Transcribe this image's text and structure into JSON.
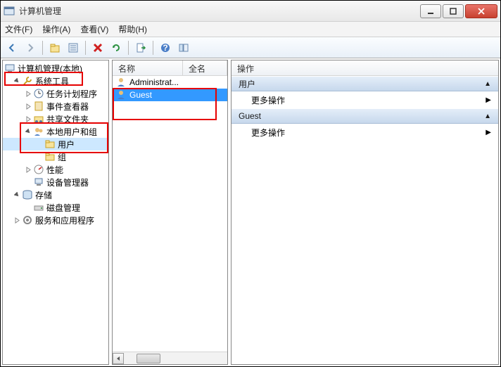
{
  "window": {
    "title": "计算机管理"
  },
  "menu": {
    "file": "文件(F)",
    "action": "操作(A)",
    "view": "查看(V)",
    "help": "帮助(H)"
  },
  "tree": {
    "root": "计算机管理(本地)",
    "system_tools": "系统工具",
    "task_scheduler": "任务计划程序",
    "event_viewer": "事件查看器",
    "shared_folders": "共享文件夹",
    "local_users_groups": "本地用户和组",
    "users": "用户",
    "groups": "组",
    "performance": "性能",
    "device_manager": "设备管理器",
    "storage": "存储",
    "disk_management": "磁盘管理",
    "services_apps": "服务和应用程序"
  },
  "list": {
    "col_name": "名称",
    "col_fullname": "全名",
    "rows": {
      "admin": "Administrat...",
      "guest": "Guest"
    }
  },
  "actions": {
    "header": "操作",
    "section_users": "用户",
    "section_guest": "Guest",
    "more": "更多操作"
  }
}
